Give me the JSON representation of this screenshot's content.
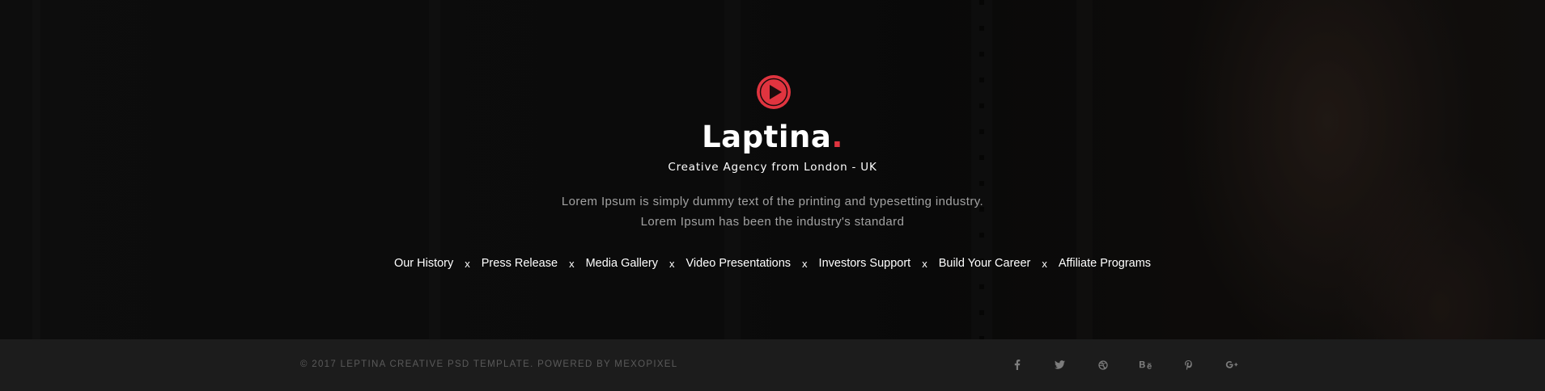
{
  "brand": {
    "name": "Laptina",
    "dot": ".",
    "tagline": "Creative Agency from London - UK",
    "icon": "play-circle-icon",
    "accent_color": "#e0343f"
  },
  "description": {
    "line1": "Lorem Ipsum is simply dummy text of the printing and typesetting industry.",
    "line2": "Lorem Ipsum has been the industry's standard"
  },
  "nav": {
    "separator": "x",
    "items": [
      {
        "label": "Our History"
      },
      {
        "label": "Press Release"
      },
      {
        "label": "Media Gallery"
      },
      {
        "label": "Video Presentations"
      },
      {
        "label": "Investors Support"
      },
      {
        "label": "Build Your Career"
      },
      {
        "label": "Affiliate Programs"
      }
    ]
  },
  "footer": {
    "copyright": "© 2017 LEPTINA CREATIVE PSD TEMPLATE. POWERED BY MEXOPIXEL",
    "social": [
      {
        "icon": "facebook-icon",
        "glyph": "f"
      },
      {
        "icon": "twitter-icon",
        "glyph": "🐦"
      },
      {
        "icon": "dribbble-icon",
        "glyph": "⊛"
      },
      {
        "icon": "behance-icon",
        "glyph": "Bē"
      },
      {
        "icon": "pinterest-icon",
        "glyph": "P"
      },
      {
        "icon": "google-plus-icon",
        "glyph": "G+"
      }
    ]
  }
}
